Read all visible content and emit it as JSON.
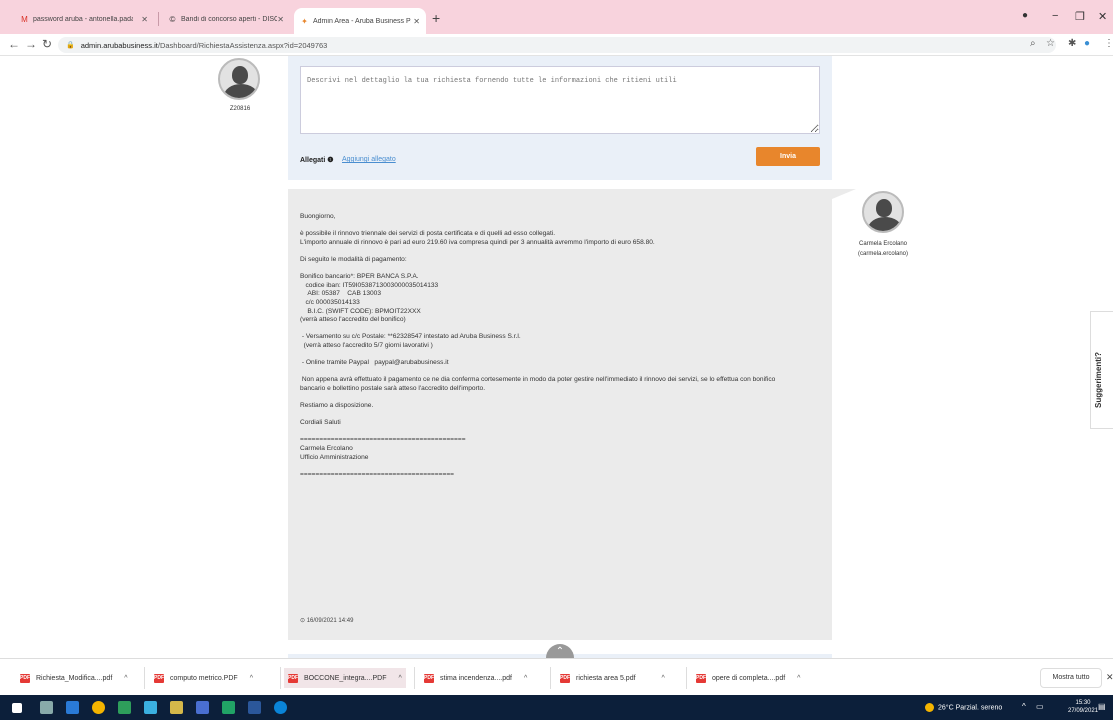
{
  "browser": {
    "tabs": [
      {
        "label": "password aruba - antonella.pada",
        "icon": "gmail-icon"
      },
      {
        "label": "Bandi di concorso aperti - DISCo",
        "icon": "disco-icon"
      },
      {
        "label": "Admin Area - Aruba Business Pa",
        "icon": "aruba-icon",
        "active": true
      }
    ],
    "url_host": "admin.arubabusiness.it",
    "url_path": "/Dashboard/RichiestaAssistenza.aspx?id=2049763"
  },
  "reply": {
    "user_name": "Z20816",
    "placeholder": "Descrivi nel dettaglio la tua richiesta fornendo tutte le informazioni che ritieni utili",
    "attachments_label": "Allegati",
    "add_attachment_label": "Aggiungi allegato",
    "send_label": "Invia"
  },
  "message": {
    "author_name": "Carmela Ercolano",
    "author_username": "(carmela.ercolano)",
    "body": "Buongiorno,\n\nè possibile il rinnovo triennale dei servizi di posta certificata e di quelli ad esso collegati.\nL'importo annuale di rinnovo è pari ad euro 219.60 iva compresa quindi per 3 annualità avremmo l'importo di euro 658.80.\n\nDi seguito le modalità di pagamento:\n\nBonifico bancario*: BPER BANCA S.P.A.\n   codice iban: IT59I0538713003000035014133\n    ABI: 05387    CAB 13003\n   c/c 000035014133\n    B.I.C. (SWIFT CODE): BPMOIT22XXX\n(verrà atteso l'accredito del bonifico)\n\n - Versamento su c/c Postale: **62328547 intestato ad Aruba Business S.r.l.\n  (verrà atteso l'accredito 5/7 giorni lavorativi )\n\n - Online tramite Paypal   paypal@arubabusiness.it\n\n Non appena avrà effettuato il pagamento ce ne dia conferma cortesemente in modo da poter gestire nell'immediato il rinnovo dei servizi, se lo effettua con bonifico\nbancario e bollettino postale sarà atteso l'accredito dell'importo.\n\nRestiamo a disposizione.\n\nCordiali Saluti\n\n===========================================\nCarmela Ercolano\nUfficio Amministrazione\n\n========================================",
    "date": "16/09/2021 14:49"
  },
  "suggest_label": "Suggerimenti?",
  "downloads": {
    "items": [
      "Richiesta_Modifica....pdf",
      "computo metrico.PDF",
      "BOCCONE_integra....PDF",
      "stima incendenza....pdf",
      "richiesta area 5.pdf",
      "opere di completa....pdf"
    ],
    "show_all_label": "Mostra tutto"
  },
  "taskbar": {
    "weather": "26°C  Parzial. sereno",
    "time": "15:30",
    "date": "27/09/2021"
  },
  "colors": {
    "tabbar": "#f8d3dd",
    "send_button": "#e8862c",
    "message_bg": "#ebebeb",
    "reply_bg": "#eaf0f8",
    "taskbar": "#0c1f3a"
  }
}
